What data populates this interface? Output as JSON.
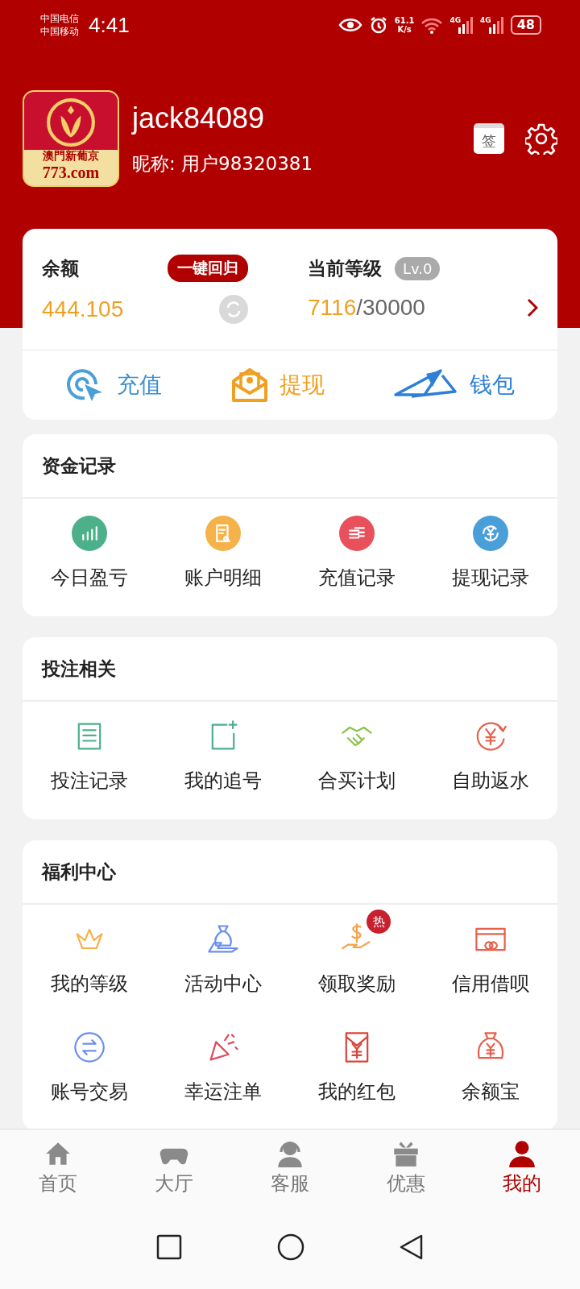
{
  "status_bar": {
    "carriers": [
      "中国电信",
      "中国移动"
    ],
    "time": "4:41",
    "speed": [
      "61.1",
      "K/s"
    ],
    "networks": [
      "4G",
      "4G"
    ],
    "battery": "48"
  },
  "profile": {
    "logo_text": [
      "澳門新葡京",
      "773.com"
    ],
    "username": "jack84089",
    "nickname": "昵称: 用户98320381",
    "sign_in": "签"
  },
  "balance_card": {
    "balance_label": "余额",
    "recall_button": "一键回归",
    "balance": "444.105",
    "level_label": "当前等级",
    "level_badge": "Lv.0",
    "progress_current": "7116",
    "progress_total": "/30000",
    "actions": [
      {
        "label": "充值"
      },
      {
        "label": "提现"
      },
      {
        "label": "钱包"
      }
    ]
  },
  "sections": [
    {
      "title": "资金记录",
      "items": [
        {
          "label": "今日盈亏"
        },
        {
          "label": "账户明细"
        },
        {
          "label": "充值记录"
        },
        {
          "label": "提现记录"
        }
      ]
    },
    {
      "title": "投注相关",
      "items": [
        {
          "label": "投注记录"
        },
        {
          "label": "我的追号"
        },
        {
          "label": "合买计划"
        },
        {
          "label": "自助返水"
        }
      ]
    },
    {
      "title": "福利中心",
      "items": [
        {
          "label": "我的等级"
        },
        {
          "label": "活动中心"
        },
        {
          "label": "领取奖励",
          "badge": "热"
        },
        {
          "label": "信用借呗"
        },
        {
          "label": "账号交易"
        },
        {
          "label": "幸运注单"
        },
        {
          "label": "我的红包"
        },
        {
          "label": "余额宝"
        }
      ]
    }
  ],
  "bottom_nav": [
    {
      "label": "首页",
      "selected": false
    },
    {
      "label": "大厅",
      "selected": false
    },
    {
      "label": "客服",
      "selected": false
    },
    {
      "label": "优惠",
      "selected": false
    },
    {
      "label": "我的",
      "selected": true
    }
  ]
}
